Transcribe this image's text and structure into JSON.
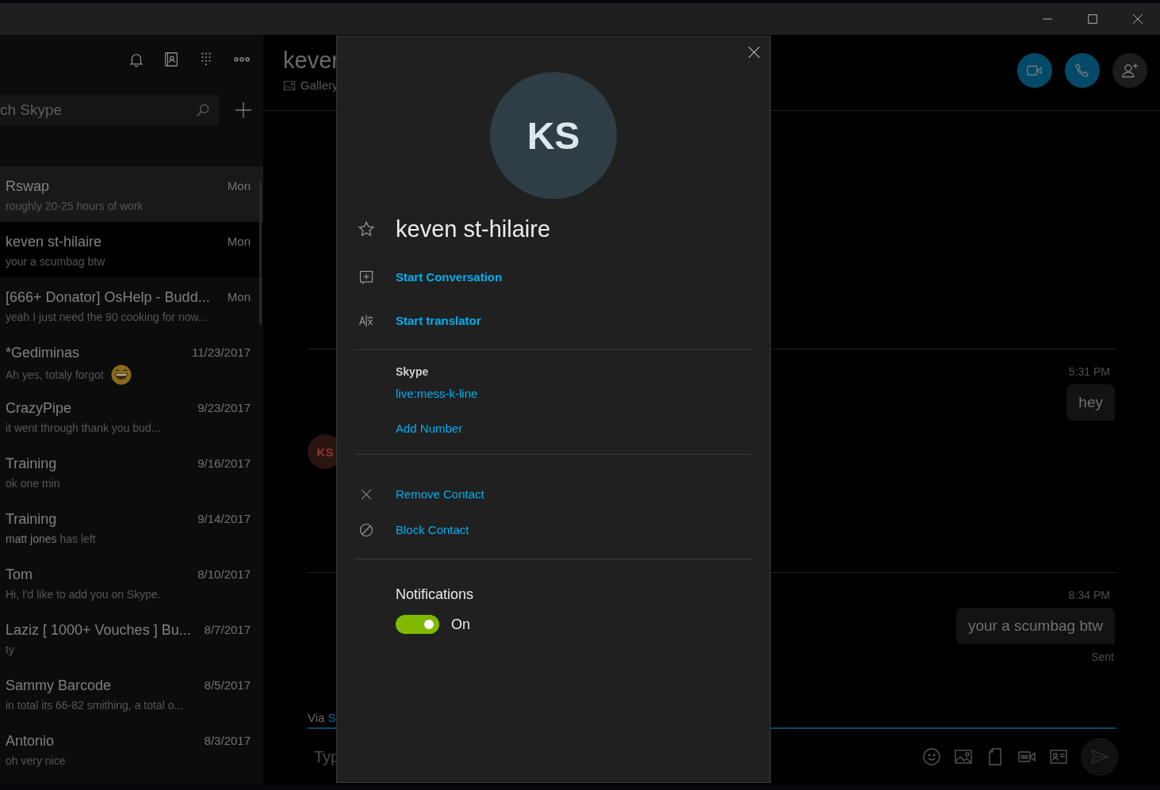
{
  "sidebar": {
    "search": {
      "placeholder": "ch Skype"
    },
    "chats": [
      {
        "name": "Rswap",
        "time": "Mon",
        "preview": "roughly 20-25 hours of work",
        "selected": false,
        "hovered": true,
        "has_emoji": false
      },
      {
        "name": "keven st-hilaire",
        "time": "Mon",
        "preview": "your a scumbag btw",
        "selected": true,
        "hovered": false,
        "has_emoji": false
      },
      {
        "name": "[666+ Donator] OsHelp - Budd...",
        "time": "Mon",
        "preview": "yeah I just need the 90 cooking for now...",
        "selected": false,
        "hovered": false,
        "has_emoji": false
      },
      {
        "name": "*Gediminas",
        "time": "11/23/2017",
        "preview": "Ah yes, totaly forgot",
        "selected": false,
        "hovered": false,
        "has_emoji": true
      },
      {
        "name": "CrazyPipe",
        "time": "9/23/2017",
        "preview": "it went through thank you bud...",
        "selected": false,
        "hovered": false,
        "has_emoji": false
      },
      {
        "name": "Training",
        "time": "9/16/2017",
        "preview": "ok one min",
        "selected": false,
        "hovered": false,
        "has_emoji": false
      },
      {
        "name": "Training",
        "time": "9/14/2017",
        "preview": "**matt jones** has left",
        "selected": false,
        "hovered": false,
        "has_emoji": false
      },
      {
        "name": "Tom",
        "time": "8/10/2017",
        "preview": "Hi, I'd like to add you on Skype.",
        "selected": false,
        "hovered": false,
        "has_emoji": false
      },
      {
        "name": "Laziz [ 1000+ Vouches ] Bu...",
        "time": "8/7/2017",
        "preview": "ty",
        "selected": false,
        "hovered": false,
        "has_emoji": false
      },
      {
        "name": "Sammy Barcode",
        "time": "8/5/2017",
        "preview": "in total its 66-82 smithing, a total o...",
        "selected": false,
        "hovered": false,
        "has_emoji": false
      },
      {
        "name": "Antonio",
        "time": "8/3/2017",
        "preview": "oh very nice",
        "selected": false,
        "hovered": false,
        "has_emoji": false
      }
    ]
  },
  "conversation": {
    "title": "kever",
    "gallery_label": "Gallery",
    "contact_initials": "KS",
    "messages": [
      {
        "time": "5:31 PM",
        "text": "hey"
      },
      {
        "time": "8:34 PM",
        "text": "your a scumbag btw",
        "status": "Sent"
      }
    ],
    "via_label": "Via",
    "via_link": "S",
    "composer": {
      "placeholder": "Typ"
    }
  },
  "profile": {
    "initials": "KS",
    "name": "keven st-hilaire",
    "actions": [
      {
        "kind": "conversation",
        "label": "Start Conversation"
      },
      {
        "kind": "translator",
        "label": "Start translator"
      }
    ],
    "skype": {
      "label": "Skype",
      "id": "live:mess-k-line",
      "add_number": "Add Number"
    },
    "contact_actions": [
      {
        "kind": "remove",
        "label": "Remove Contact"
      },
      {
        "kind": "block",
        "label": "Block Contact"
      }
    ],
    "notifications": {
      "label": "Notifications",
      "on": true,
      "state_label": "On"
    }
  }
}
